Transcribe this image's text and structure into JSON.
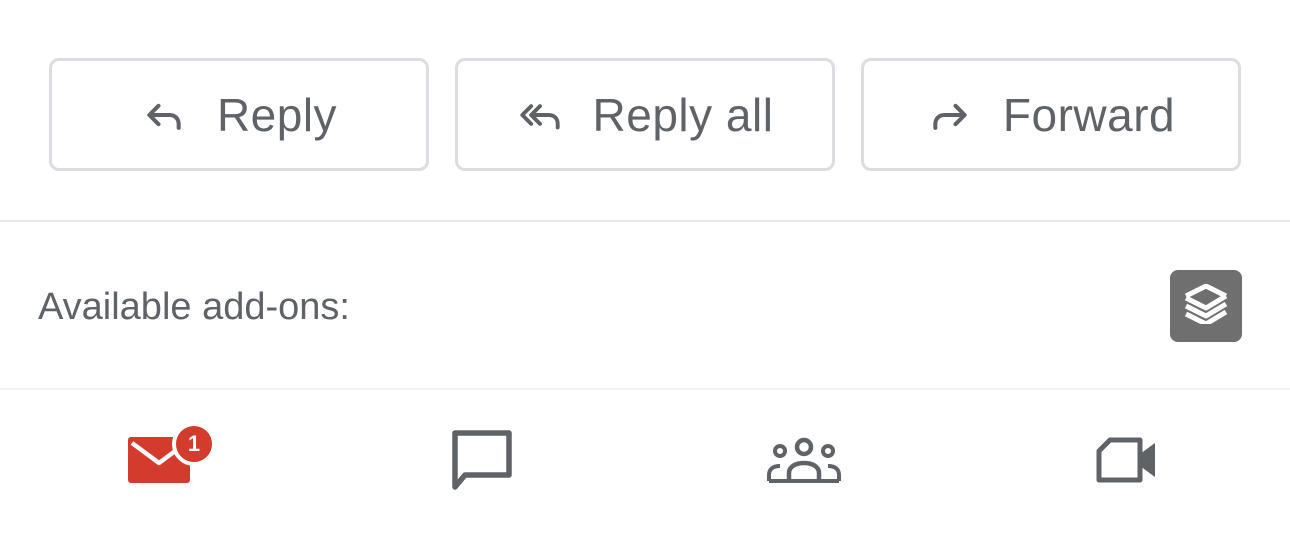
{
  "actions": {
    "reply": {
      "label": "Reply",
      "icon": "reply-icon"
    },
    "reply_all": {
      "label": "Reply all",
      "icon": "reply-all-icon"
    },
    "forward": {
      "label": "Forward",
      "icon": "forward-icon"
    }
  },
  "addons": {
    "label": "Available add-ons:",
    "items": [
      {
        "icon": "todoist-layers-icon"
      }
    ]
  },
  "bottom_nav": {
    "items": [
      {
        "id": "mail",
        "icon": "mail-icon",
        "badge": "1",
        "active": true,
        "color": "#d33b2c"
      },
      {
        "id": "chat",
        "icon": "chat-icon",
        "active": false,
        "color": "#5f6368"
      },
      {
        "id": "spaces",
        "icon": "spaces-icon",
        "active": false,
        "color": "#5f6368"
      },
      {
        "id": "meet",
        "icon": "meet-icon",
        "active": false,
        "color": "#5f6368"
      }
    ]
  },
  "colors": {
    "text": "#5f6368",
    "border": "#dcdde0",
    "accent": "#d33b2c",
    "addon_bg": "#6f6f6f"
  }
}
